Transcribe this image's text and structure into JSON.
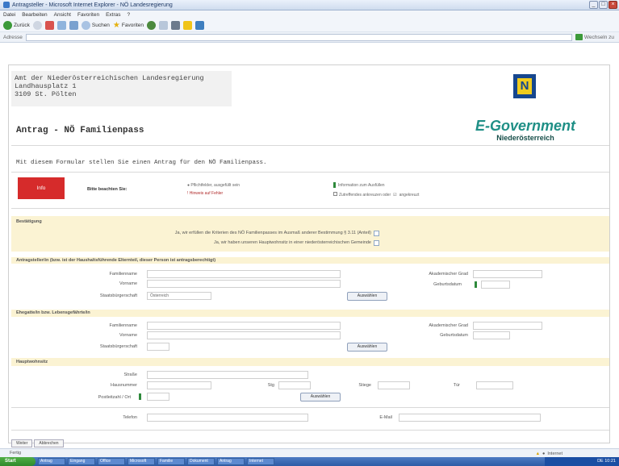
{
  "window": {
    "title": "Antragsteller - Microsoft Internet Explorer - NÖ Landesregierung"
  },
  "menu": [
    "Datei",
    "Bearbeiten",
    "Ansicht",
    "Favoriten",
    "Extras",
    "?"
  ],
  "toolbar": {
    "back": "Zurück",
    "search": "Suchen",
    "favorites": "Favoriten"
  },
  "address": {
    "label": "Adresse",
    "go": "Wechseln zu"
  },
  "header": {
    "addr_line1": "Amt der Niederösterreichischen Landesregierung",
    "addr_line2": "Landhausplatz 1",
    "addr_line3": "3109 St. Pölten",
    "logo_letter": "N",
    "egov": "E-Government",
    "egov_sub": "Niederösterreich",
    "title": "Antrag - NÖ Familienpass",
    "intro": "Mit diesem Formular stellen Sie einen Antrag für den NÖ Familienpass."
  },
  "info": {
    "button": "Info",
    "hint": "Bitte beachten Sie:",
    "legend_required": "● Pflichtfelder, ausgefüllt sein",
    "legend_error": "! Hinweis auf Fehler",
    "legend_info": "Information zum Ausfüllen",
    "legend_choice": "Zutreffendes ankreuzen oder",
    "legend_ticked": "angekreuzt"
  },
  "sections": {
    "confirm": {
      "title": "Bestätigung",
      "q1": "Ja, wir erfüllen die Kriterien des NÖ Familienpasses im Ausmaß anderer Bestimmung § 3.11 (Anteil)",
      "q2": "Ja, wir haben unseren Hauptwohnsitz in einer niederösterreichischen Gemeinde"
    },
    "applicant": {
      "title": "Antragsteller/in (bzw. ist der Haushaltsführende Elternteil, dieser Person ist antragsberechtigt)",
      "surname": "Familienname",
      "firstname": "Vorname",
      "nationality": "Staatsbürgerschaft",
      "nationality_value": "Österreich",
      "degree": "Akademischer Grad",
      "birthdate": "Geburtsdatum",
      "select": "Auswählen"
    },
    "partner": {
      "title": "Ehegatte/in bzw. Lebensgefährte/in",
      "surname": "Familienname",
      "firstname": "Vorname",
      "nationality": "Staatsbürgerschaft",
      "degree": "Akademischer Grad",
      "birthdate": "Geburtsdatum",
      "select": "Auswählen"
    },
    "residence": {
      "title": "Hauptwohnsitz",
      "street": "Straße",
      "housenumber": "Hausnummer",
      "stairs": "Stg",
      "floor": "Stiege",
      "door": "Tür",
      "postcode": "Postleitzahl / Ort",
      "select": "Auswählen",
      "phone": "Telefon",
      "email": "E-Mail"
    }
  },
  "bottom": {
    "tab1": "Weiter",
    "tab2": "Abbrechen"
  },
  "status": {
    "left": "Fertig",
    "zone": "Internet"
  },
  "taskbar": {
    "start": "Start",
    "items": [
      "Antrag",
      "Eingang",
      "Office",
      "Microsoft",
      "Familie",
      "Dokument",
      "Antrag",
      "Internet"
    ],
    "clock": "DE 10:21"
  }
}
